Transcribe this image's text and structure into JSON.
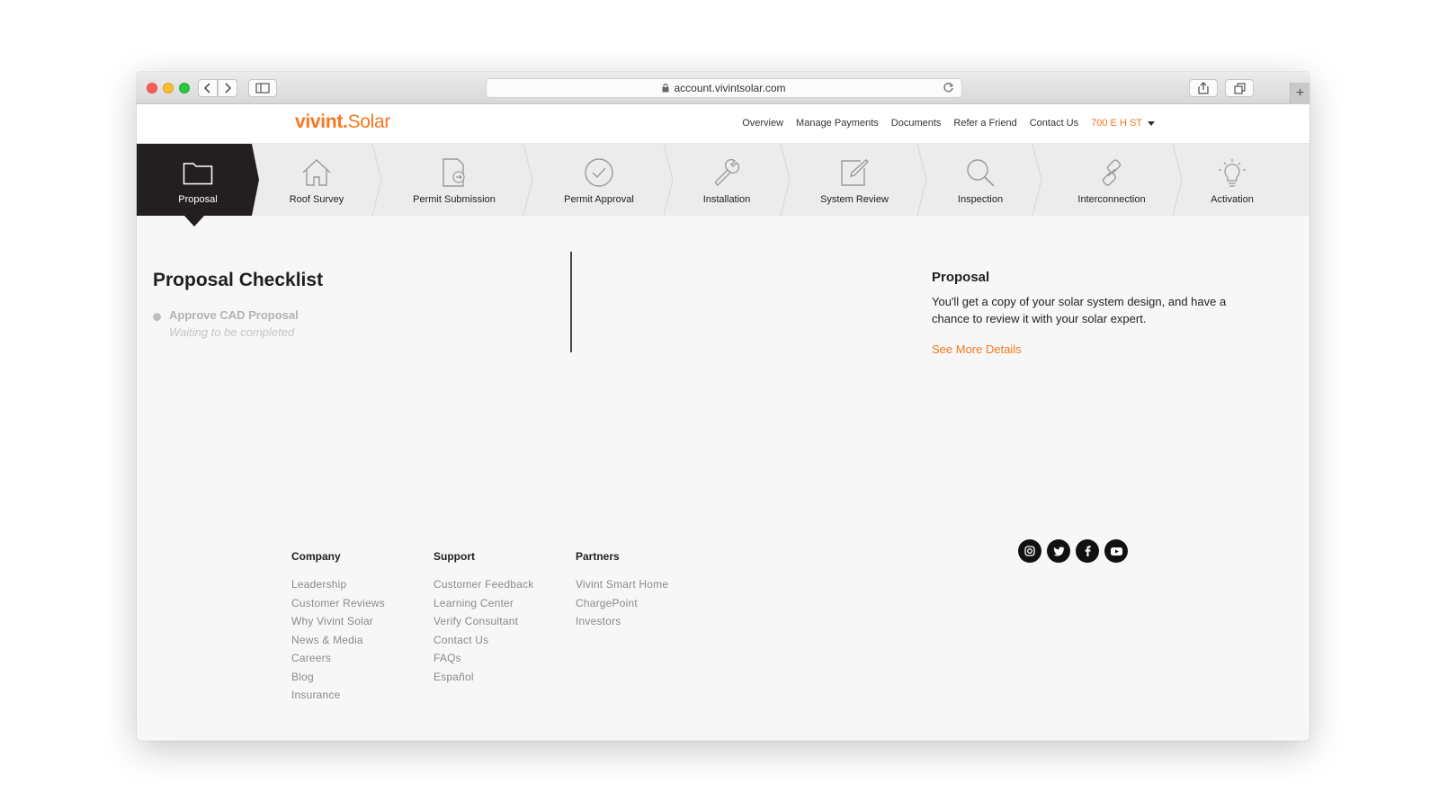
{
  "browser": {
    "url": "account.vivintsolar.com"
  },
  "header": {
    "logo_left": "vivint.",
    "logo_right": "Solar",
    "nav": [
      "Overview",
      "Manage Payments",
      "Documents",
      "Refer a Friend",
      "Contact Us"
    ],
    "address": "700 E H ST",
    "brand_color": "#f7771e"
  },
  "steps": [
    {
      "label": "Proposal",
      "icon": "folder-icon",
      "active": true
    },
    {
      "label": "Roof Survey",
      "icon": "house-icon",
      "active": false
    },
    {
      "label": "Permit Submission",
      "icon": "document-arrow-icon",
      "active": false
    },
    {
      "label": "Permit Approval",
      "icon": "check-circle-icon",
      "active": false
    },
    {
      "label": "Installation",
      "icon": "wrench-icon",
      "active": false
    },
    {
      "label": "System Review",
      "icon": "edit-icon",
      "active": false
    },
    {
      "label": "Inspection",
      "icon": "magnifier-icon",
      "active": false
    },
    {
      "label": "Interconnection",
      "icon": "link-icon",
      "active": false
    },
    {
      "label": "Activation",
      "icon": "lightbulb-icon",
      "active": false
    }
  ],
  "checklist": {
    "title": "Proposal Checklist",
    "items": [
      {
        "name": "Approve CAD Proposal",
        "status": "Waiting to be completed"
      }
    ]
  },
  "detail": {
    "title": "Proposal",
    "description": "You'll get a copy of your solar system design, and have a chance to review it with your solar expert.",
    "link": "See More Details"
  },
  "footer": {
    "company": {
      "heading": "Company",
      "links": [
        "Leadership",
        "Customer Reviews",
        "Why Vivint Solar",
        "News & Media",
        "Careers",
        "Blog",
        "Insurance"
      ]
    },
    "support": {
      "heading": "Support",
      "links": [
        "Customer Feedback",
        "Learning Center",
        "Verify Consultant",
        "Contact Us",
        "FAQs",
        "Español"
      ]
    },
    "partners": {
      "heading": "Partners",
      "links": [
        "Vivint Smart Home",
        "ChargePoint",
        "Investors"
      ]
    },
    "social": [
      "instagram-icon",
      "twitter-icon",
      "facebook-icon",
      "youtube-icon"
    ]
  }
}
